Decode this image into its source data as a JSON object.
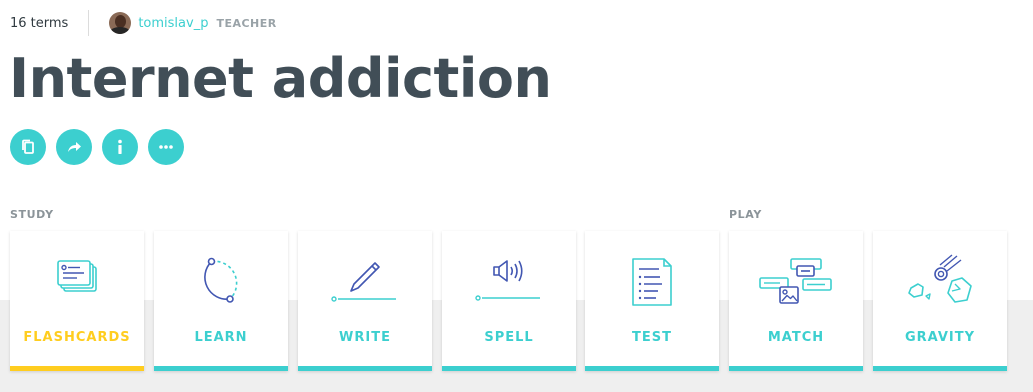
{
  "header": {
    "terms_count": "16 terms",
    "username": "tomislav_p",
    "role": "TEACHER"
  },
  "set": {
    "title": "Internet addiction"
  },
  "actions": [
    {
      "icon": "copy-icon"
    },
    {
      "icon": "share-icon"
    },
    {
      "icon": "info-icon"
    },
    {
      "icon": "more-icon"
    }
  ],
  "sections": {
    "study": "STUDY",
    "play": "PLAY"
  },
  "modes": [
    {
      "label": "FLASHCARDS",
      "icon": "flashcards-icon",
      "active": true
    },
    {
      "label": "LEARN",
      "icon": "learn-icon"
    },
    {
      "label": "WRITE",
      "icon": "write-icon"
    },
    {
      "label": "SPELL",
      "icon": "spell-icon"
    },
    {
      "label": "TEST",
      "icon": "test-icon"
    },
    {
      "label": "MATCH",
      "icon": "match-icon"
    },
    {
      "label": "GRAVITY",
      "icon": "gravity-icon"
    }
  ],
  "colors": {
    "accent": "#3ccfcf",
    "active": "#ffcd1f",
    "icon_dark": "#4257b2"
  }
}
